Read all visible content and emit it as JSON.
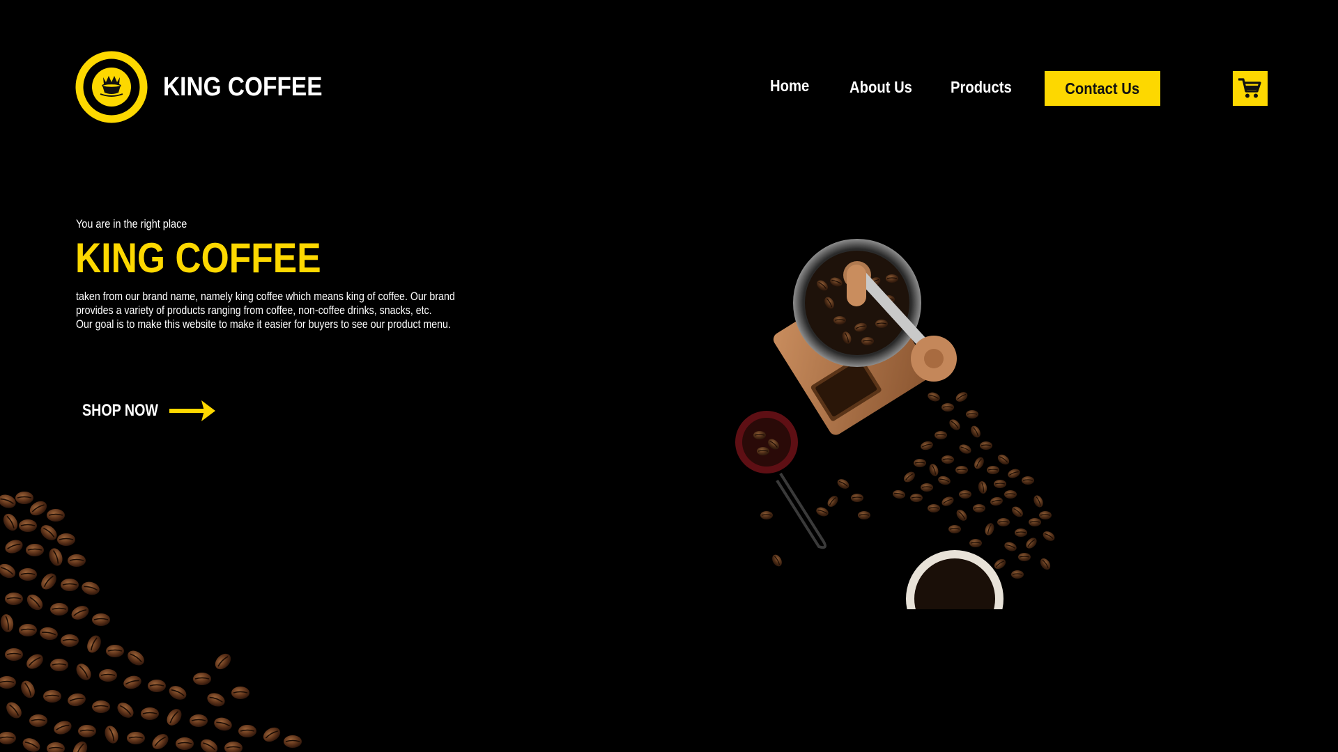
{
  "header": {
    "brand_name": "KING COFFEE",
    "logo_icon": "crown-coffee-cup-icon",
    "nav": {
      "home": "Home",
      "about": "About Us",
      "products": "Products",
      "contact": "Contact Us"
    },
    "cart_icon": "shopping-cart-icon"
  },
  "hero": {
    "tagline": "You are in the right place",
    "title": "KING COFFEE",
    "description_lines": [
      "taken from our brand name, namely king coffee which means king of coffee. Our brand",
      "provides a variety of products ranging from coffee, non-coffee drinks, snacks, etc.",
      "Our goal is to make this website to make it easier for buyers to see our product menu."
    ],
    "cta_label": "SHOP NOW",
    "cta_icon": "arrow-right-icon"
  },
  "images": {
    "grinder": "coffee-grinder-with-beans-photo",
    "corner": "coffee-beans-pile-photo"
  },
  "colors": {
    "background": "#000000",
    "accent": "#FDD800",
    "text": "#FFFFFF"
  }
}
